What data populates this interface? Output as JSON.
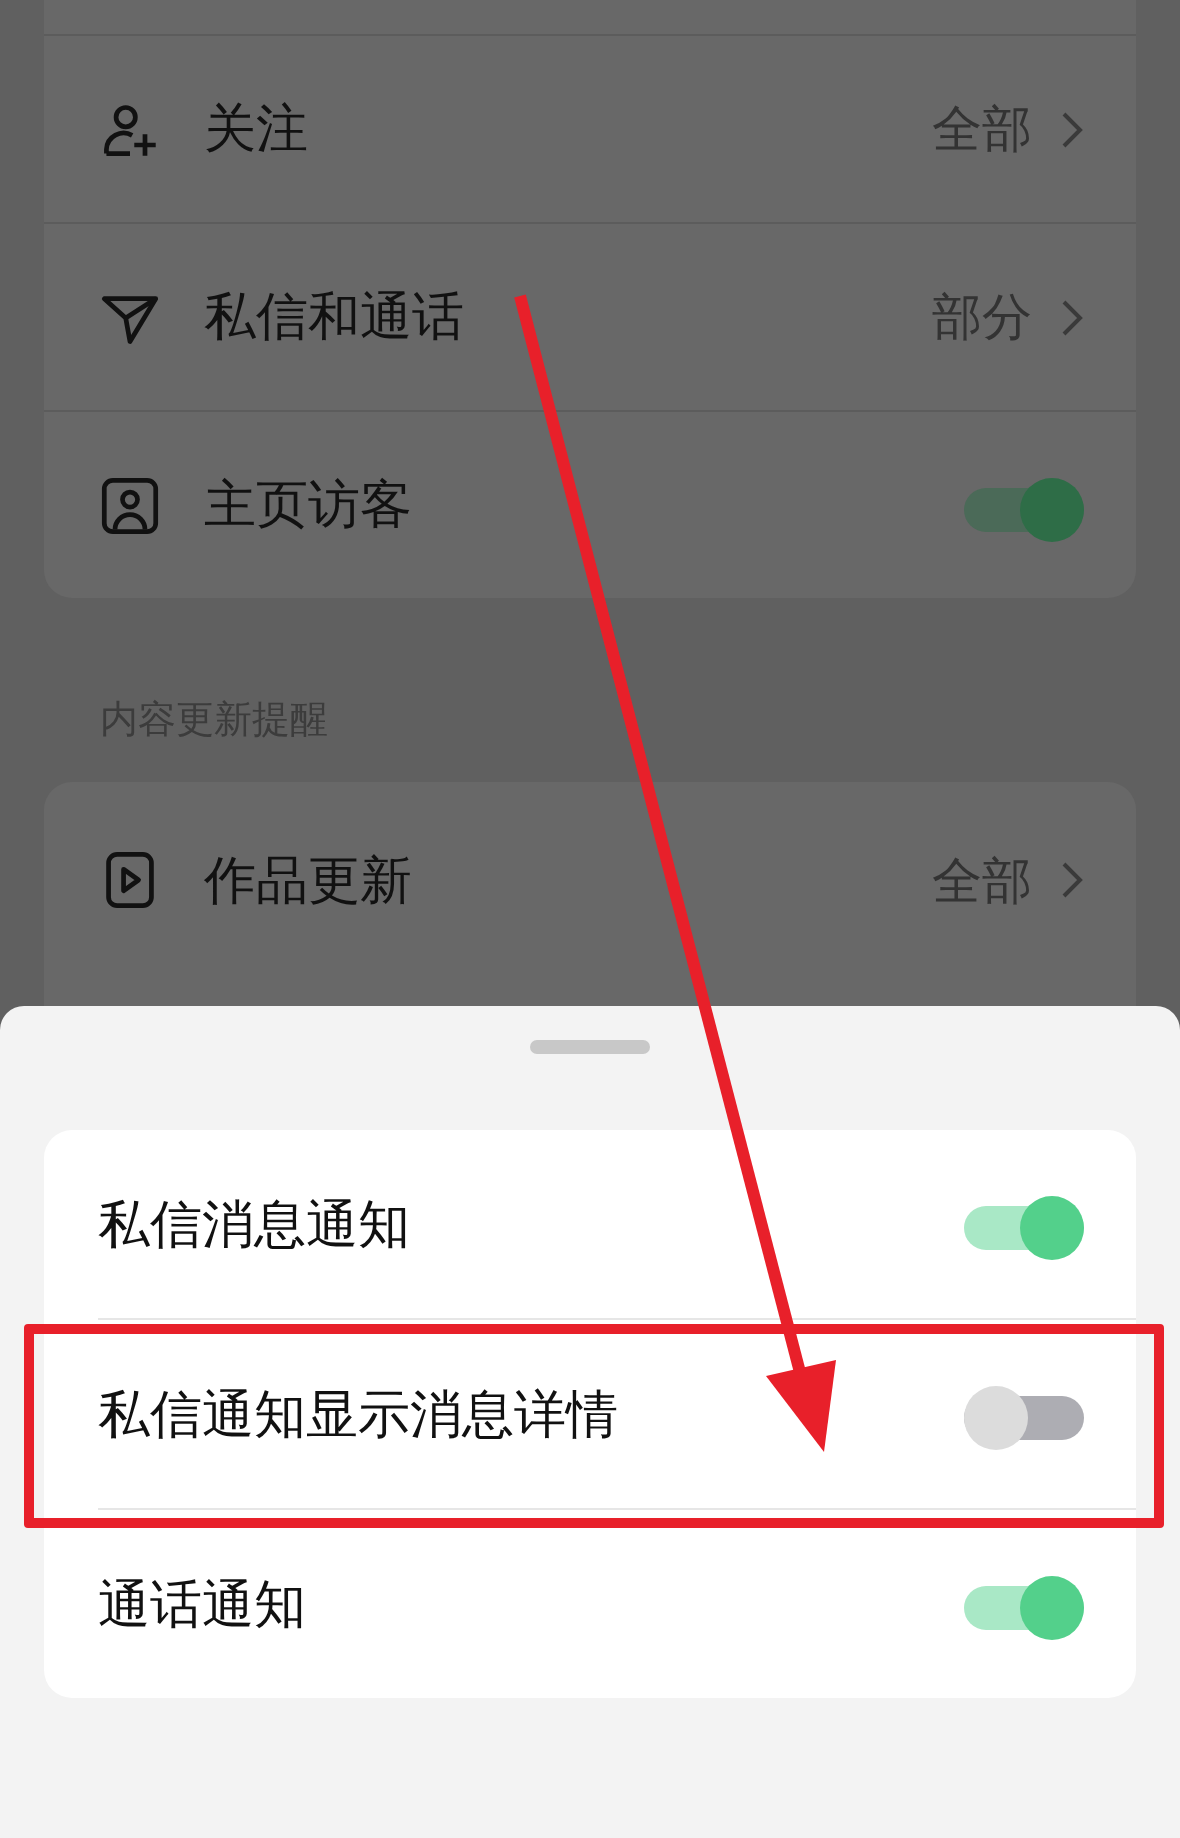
{
  "background_settings": {
    "items": [
      {
        "kind": "link",
        "label": "关注",
        "value": "全部"
      },
      {
        "kind": "link",
        "label": "私信和通话",
        "value": "部分"
      },
      {
        "kind": "toggle",
        "label": "主页访客",
        "on": true
      }
    ],
    "section_title": "内容更新提醒",
    "section_items": [
      {
        "kind": "link",
        "label": "作品更新",
        "value": "全部"
      }
    ]
  },
  "sheet": {
    "items": [
      {
        "label": "私信消息通知",
        "on": true,
        "highlighted": false
      },
      {
        "label": "私信通知显示消息详情",
        "on": false,
        "highlighted": true
      },
      {
        "label": "通话通知",
        "on": true,
        "highlighted": false
      }
    ]
  }
}
